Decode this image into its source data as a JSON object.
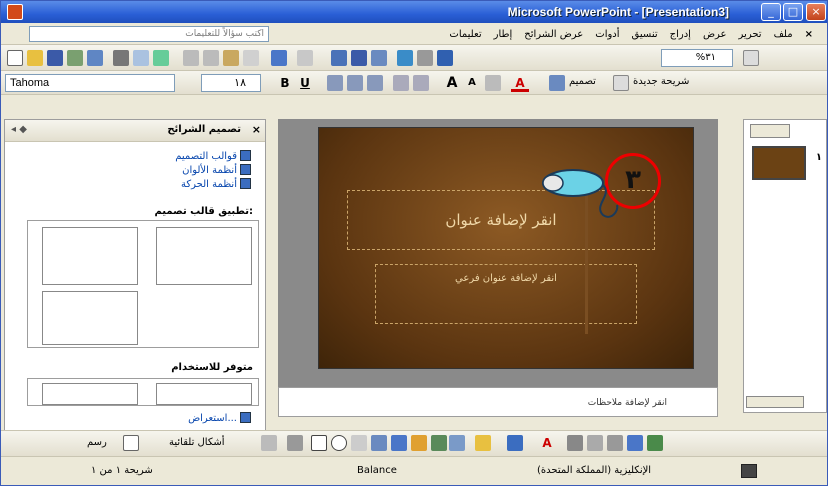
{
  "window": {
    "title": "Microsoft PowerPoint - [Presentation3]",
    "buttons": [
      "_",
      "□",
      "×"
    ]
  },
  "menubar": {
    "items": [
      "ملف",
      "تحرير",
      "عرض",
      "إدراج",
      "تنسيق",
      "أدوات",
      "عرض الشرائح",
      "إطار",
      "تعليمات"
    ],
    "close_doc": "×",
    "ask_placeholder": "اكتب سؤالاً للتعليمات"
  },
  "format_toolbar": {
    "font": "Tahoma",
    "size": "١٨",
    "zoom": "%٣١",
    "design_label": "تصميم",
    "new_slide_label": "شريحة جديدة"
  },
  "task_pane": {
    "title": "تصميم الشرائح",
    "links": [
      "قوالب التصميم",
      "أنظمة الألوان",
      "أنظمة الحركة"
    ],
    "apply_section": "تطبيق قالب تصميم:",
    "available_section": "متوفر للاستخدام",
    "browse_link": "استعراض..."
  },
  "slide": {
    "title_placeholder": "انقر لإضافة عنوان",
    "subtitle_placeholder": "انقر لإضافة عنوان فرعي"
  },
  "notes": {
    "placeholder": "انقر لإضافة ملاحظات"
  },
  "thumbnails": {
    "slide_number": "١"
  },
  "drawing_toolbar": {
    "draw_label": "رسم",
    "autoshapes_label": "أشكال تلقائية"
  },
  "status": {
    "slide_count": "شريحة ١ من ١",
    "design": "Balance",
    "language": "الإنكليزية (المملكة المتحدة)"
  },
  "annotation": {
    "number": "٣"
  }
}
